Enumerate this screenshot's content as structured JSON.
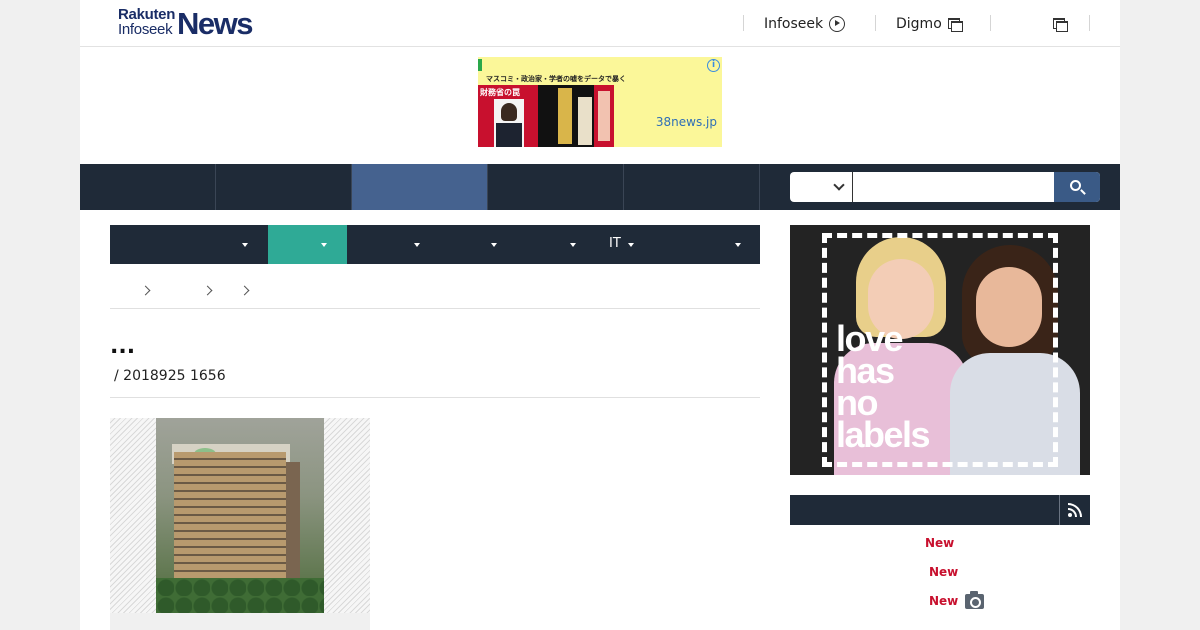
{
  "header": {
    "logo": {
      "line1": "Rakuten",
      "line2": "Infoseek",
      "brand": "News"
    },
    "links": [
      {
        "label": "Infoseek",
        "icon": "play-circle-icon"
      },
      {
        "label": "Digmo",
        "icon": "new-window-icon"
      }
    ],
    "extra_icon": "new-window-icon"
  },
  "ad_top": {
    "tagline": "マスコミ・政治家・学者の嘘をデータで暴く",
    "book_title": "財務省の罠",
    "source": "38news.jp",
    "info_glyph": "i"
  },
  "main_nav": {
    "active_index": 2
  },
  "search": {
    "value": "",
    "placeholder": ""
  },
  "sub_nav": {
    "active_index": 1,
    "items": [
      "",
      "",
      "",
      "",
      "",
      "IT",
      ""
    ]
  },
  "article": {
    "title": "...",
    "meta": "/ 2018925 1656"
  },
  "ranking": {
    "badges": [
      "New",
      "New",
      "New"
    ]
  },
  "side_ad": {
    "slogan": [
      "love",
      "has",
      "no",
      "labels"
    ]
  },
  "colors": {
    "nav_bg": "#1f2a38",
    "nav_active": "#45628f",
    "subnav_active": "#2faa96",
    "badge_red": "#c8102e",
    "search_btn": "#3a5a86"
  }
}
